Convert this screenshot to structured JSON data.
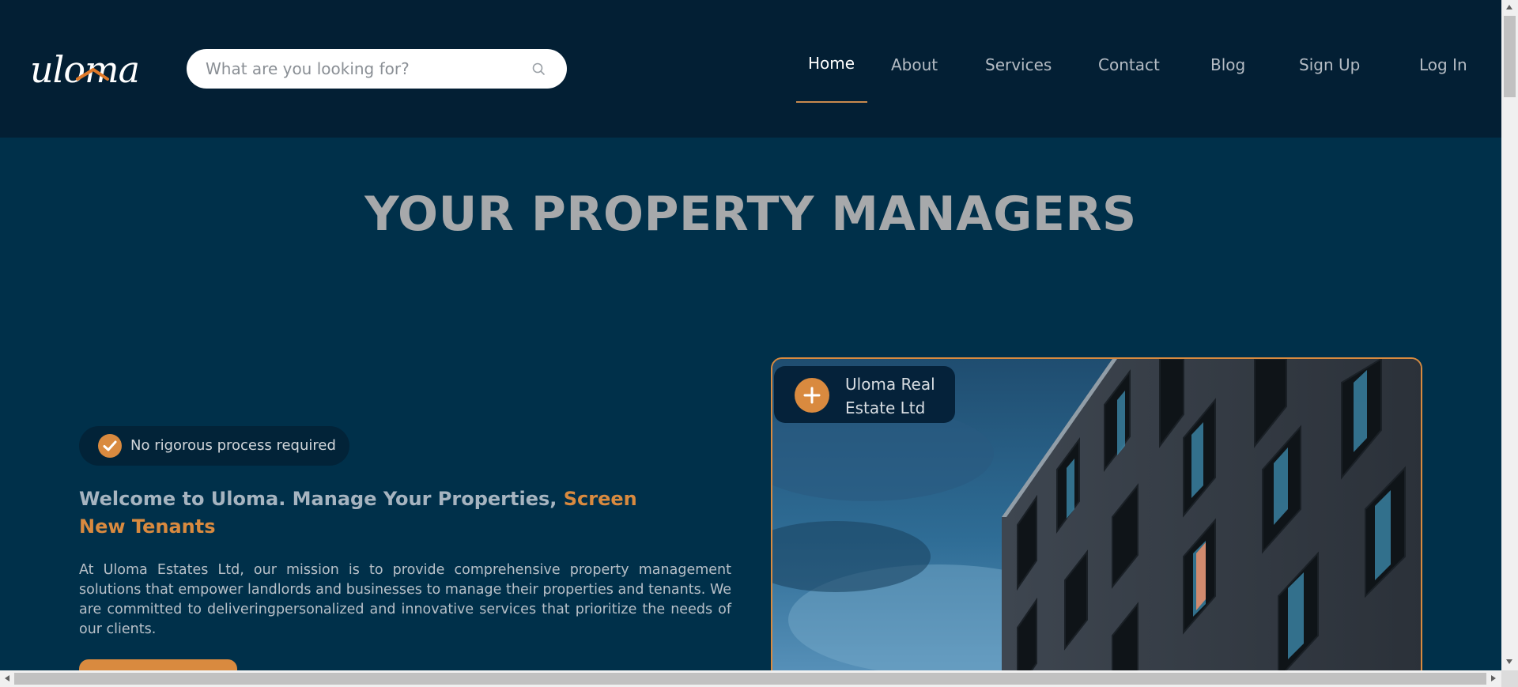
{
  "brand": {
    "logo_text": "uloma"
  },
  "search": {
    "placeholder": "What are you looking for?"
  },
  "nav": {
    "items": [
      {
        "label": "Home",
        "active": true
      },
      {
        "label": "About"
      },
      {
        "label": "Services"
      },
      {
        "label": "Contact"
      },
      {
        "label": "Blog"
      },
      {
        "label": "Sign Up"
      },
      {
        "label": "Log In"
      }
    ]
  },
  "hero": {
    "title": "YOUR PROPERTY MANAGERS",
    "badge_label": "No rigorous process required",
    "welcome_main": "Welcome to Uloma. Manage Your Properties, ",
    "welcome_accent": "Screen New Tenants",
    "mission": "At Uloma Estates Ltd, our mission is to provide comprehensive property management solutions that empower landlords and businesses to manage their properties and tenants. We are committed to deliveringpersonalized and innovative services that prioritize the needs of our clients.",
    "company_name": "Uloma Real Estate Ltd"
  },
  "colors": {
    "header_bg": "#031f34",
    "page_bg": "#00304a",
    "accent": "#d98a3f",
    "title_gray": "#a7a9ab"
  },
  "icons": {
    "search": "search-icon",
    "check": "check-icon",
    "plus": "plus-icon"
  }
}
